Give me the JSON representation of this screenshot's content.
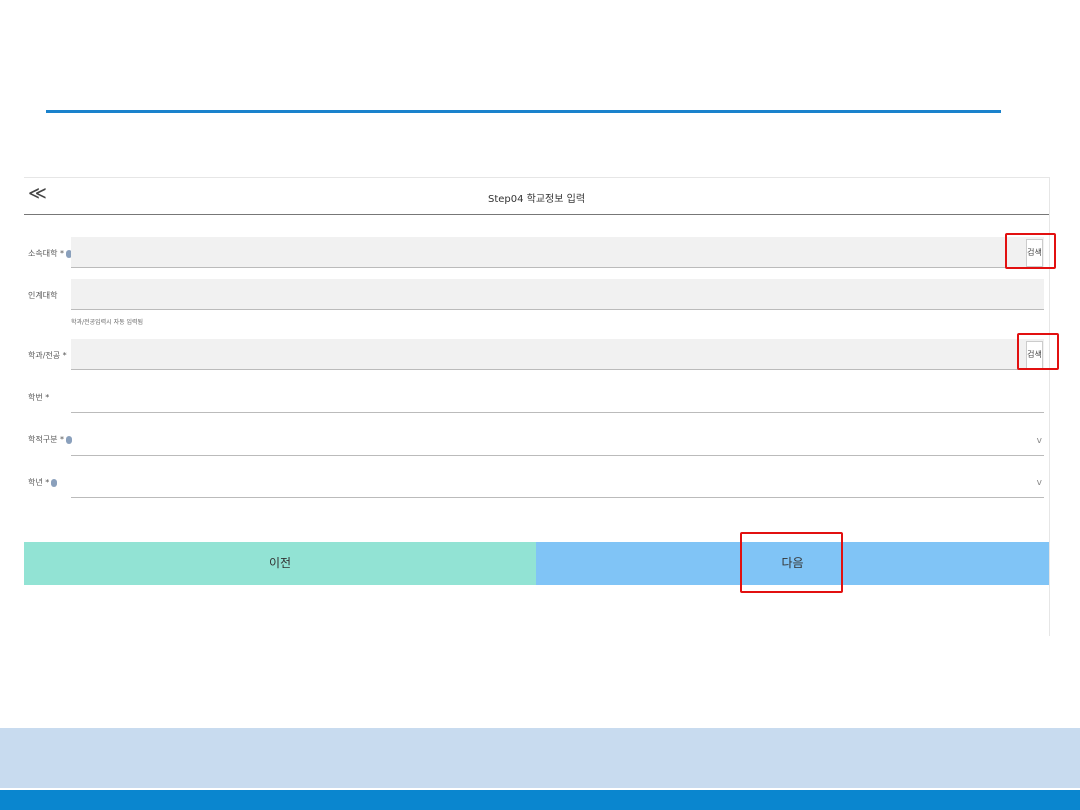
{
  "header": {
    "back_icon": "≪",
    "title": "Step04 학교정보 입력"
  },
  "form": {
    "university_label": "소속대학 *",
    "exchange_label": "인계대학",
    "hint": "학과/전공입력시 자동 입력됨",
    "major_label": "학과/전공 *",
    "student_id_label": "학번 *",
    "status_label": "학적구분 *",
    "grade_label": "학년 *",
    "search_label": "검색",
    "select_chevron": "v"
  },
  "buttons": {
    "prev": "이전",
    "next": "다음"
  },
  "colors": {
    "accent": "#1a82cc",
    "prev_bg": "#92e3d4",
    "next_bg": "#80c4f6",
    "highlight": "#e21010"
  }
}
